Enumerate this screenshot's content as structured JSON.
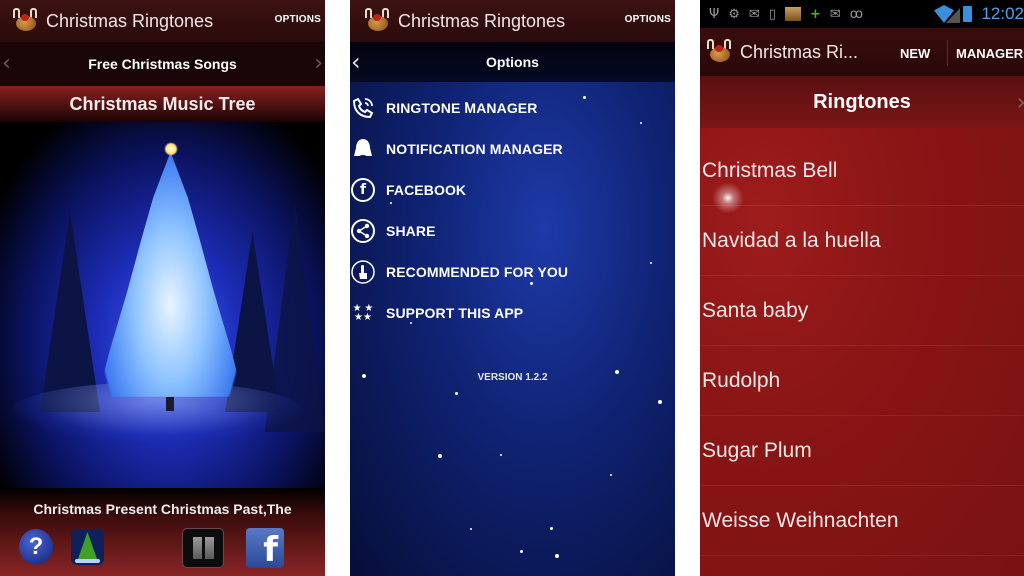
{
  "screens": [
    {
      "app_title": "Christmas Ringtones",
      "action_options": "OPTIONS",
      "subbar_title": "Free Christmas Songs",
      "nav_prev_icon": "chevron-left-icon",
      "nav_next_icon": "chevron-right-icon",
      "header_title": "Christmas Music Tree",
      "now_playing": "Christmas Present Christmas Past,The",
      "bottom_buttons": [
        {
          "name": "help-button",
          "icon": "question-icon",
          "glyph": "?"
        },
        {
          "name": "tree-button",
          "icon": "christmas-tree-icon"
        },
        {
          "name": "pause-button",
          "icon": "pause-icon"
        },
        {
          "name": "facebook-button",
          "icon": "facebook-icon",
          "glyph": "f"
        }
      ]
    },
    {
      "app_title": "Christmas Ringtones",
      "action_options": "OPTIONS",
      "subbar_title": "Options",
      "back_icon": "chevron-left-icon",
      "menu_items": [
        {
          "label": "RINGTONE MANAGER",
          "icon": "phone-ringing-icon"
        },
        {
          "label": "NOTIFICATION MANAGER",
          "icon": "bell-icon"
        },
        {
          "label": "FACEBOOK",
          "icon": "facebook-icon",
          "glyph": "f"
        },
        {
          "label": "SHARE",
          "icon": "share-icon"
        },
        {
          "label": "RECOMMENDED FOR YOU",
          "icon": "touch-icon"
        },
        {
          "label": "SUPPORT THIS APP",
          "icon": "stars-icon"
        }
      ],
      "version": "VERSION 1.2.2"
    },
    {
      "status_bar": {
        "icons": [
          "usb-icon",
          "android-icon",
          "gmail-icon",
          "download-icon",
          "image-notification-icon",
          "plus-icon",
          "email-icon",
          "voicemail-icon",
          "wifi-icon",
          "signal-icon",
          "battery-charging-icon"
        ],
        "time": "12:02"
      },
      "app_title": "Christmas Ri...",
      "action_new": "NEW",
      "action_manager": "MANAGER",
      "subbar_title": "Ringtones",
      "ringtones": [
        "Christmas Bell",
        "Navidad a la huella",
        "Santa baby",
        "Rudolph",
        "Sugar Plum",
        "Weisse Weihnachten"
      ]
    }
  ]
}
